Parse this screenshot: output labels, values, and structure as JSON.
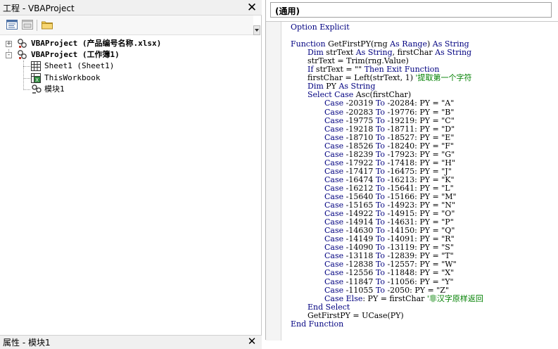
{
  "project_pane": {
    "title": "工程 - VBAProject",
    "close_glyph": "✕",
    "tree": [
      {
        "label": "VBAProject (产品编号名称.xlsx)",
        "expander": "+",
        "bold": true,
        "icon": "vba-project-icon"
      },
      {
        "label": "VBAProject (工作簿1)",
        "expander": "-",
        "bold": true,
        "icon": "vba-project-icon"
      },
      {
        "label": "Sheet1 (Sheet1)",
        "icon": "worksheet-icon"
      },
      {
        "label": "ThisWorkbook",
        "icon": "workbook-icon"
      },
      {
        "label": "模块1",
        "icon": "module-icon"
      }
    ]
  },
  "properties_pane": {
    "title": "属性 - 模块1",
    "close_glyph": "✕"
  },
  "code_window": {
    "object_combo": "(通用)",
    "lines": [
      {
        "indent": 0,
        "text": "Option Explicit"
      },
      {
        "indent": 0,
        "text": ""
      },
      {
        "indent": 0,
        "text": "Function GetFirstPY(rng As Range) As String"
      },
      {
        "indent": 1,
        "text": "Dim strText As String, firstChar As String"
      },
      {
        "indent": 1,
        "text": "strText = Trim(rng.Value)"
      },
      {
        "indent": 1,
        "text": "If strText = \"\" Then Exit Function"
      },
      {
        "indent": 1,
        "text": "firstChar = Left(strText, 1) ",
        "comment": "'提取第一个字符"
      },
      {
        "indent": 1,
        "text": "Dim PY As String"
      },
      {
        "indent": 1,
        "text": "Select Case Asc(firstChar)"
      },
      {
        "indent": 2,
        "text": "Case -20319 To -20284: PY = \"A\""
      },
      {
        "indent": 2,
        "text": "Case -20283 To -19776: PY = \"B\""
      },
      {
        "indent": 2,
        "text": "Case -19775 To -19219: PY = \"C\""
      },
      {
        "indent": 2,
        "text": "Case -19218 To -18711: PY = \"D\""
      },
      {
        "indent": 2,
        "text": "Case -18710 To -18527: PY = \"E\""
      },
      {
        "indent": 2,
        "text": "Case -18526 To -18240: PY = \"F\""
      },
      {
        "indent": 2,
        "text": "Case -18239 To -17923: PY = \"G\""
      },
      {
        "indent": 2,
        "text": "Case -17922 To -17418: PY = \"H\""
      },
      {
        "indent": 2,
        "text": "Case -17417 To -16475: PY = \"J\""
      },
      {
        "indent": 2,
        "text": "Case -16474 To -16213: PY = \"K\""
      },
      {
        "indent": 2,
        "text": "Case -16212 To -15641: PY = \"L\""
      },
      {
        "indent": 2,
        "text": "Case -15640 To -15166: PY = \"M\""
      },
      {
        "indent": 2,
        "text": "Case -15165 To -14923: PY = \"N\""
      },
      {
        "indent": 2,
        "text": "Case -14922 To -14915: PY = \"O\""
      },
      {
        "indent": 2,
        "text": "Case -14914 To -14631: PY = \"P\""
      },
      {
        "indent": 2,
        "text": "Case -14630 To -14150: PY = \"Q\""
      },
      {
        "indent": 2,
        "text": "Case -14149 To -14091: PY = \"R\""
      },
      {
        "indent": 2,
        "text": "Case -14090 To -13119: PY = \"S\""
      },
      {
        "indent": 2,
        "text": "Case -13118 To -12839: PY = \"T\""
      },
      {
        "indent": 2,
        "text": "Case -12838 To -12557: PY = \"W\""
      },
      {
        "indent": 2,
        "text": "Case -12556 To -11848: PY = \"X\""
      },
      {
        "indent": 2,
        "text": "Case -11847 To -11056: PY = \"Y\""
      },
      {
        "indent": 2,
        "text": "Case -11055 To -2050: PY = \"Z\""
      },
      {
        "indent": 2,
        "text": "Case Else: PY = firstChar ",
        "comment": "'非汉字原样返回"
      },
      {
        "indent": 1,
        "text": "End Select"
      },
      {
        "indent": 1,
        "text": "GetFirstPY = UCase(PY)"
      },
      {
        "indent": 0,
        "text": "End Function"
      }
    ]
  },
  "colors": {
    "keyword": "#000080",
    "comment": "#008000"
  }
}
